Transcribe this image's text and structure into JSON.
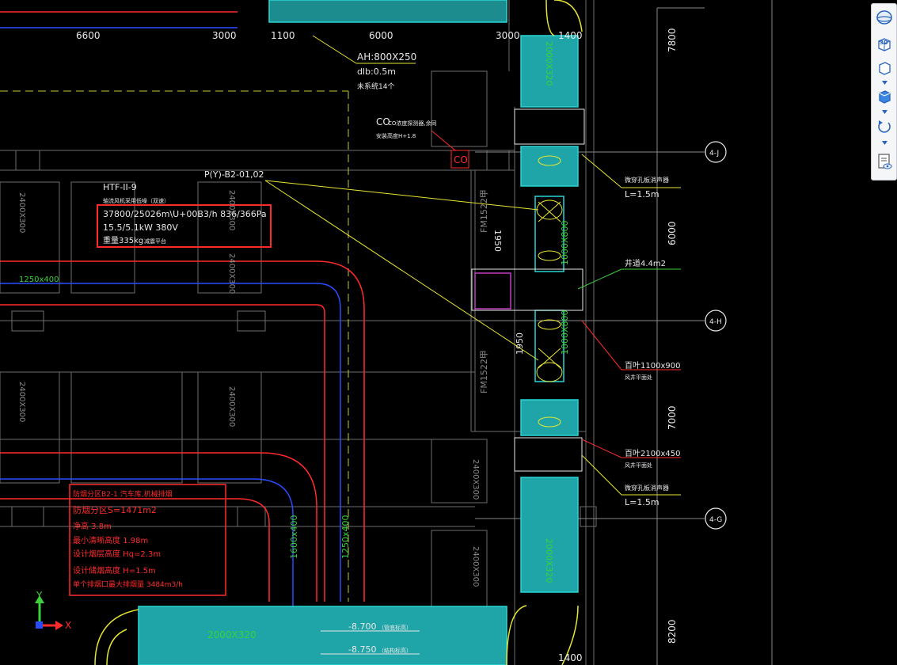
{
  "drawing": {
    "top_dims": [
      "6600",
      "3000",
      "1100",
      "6000",
      "3000",
      "1400"
    ],
    "bottom_dim": "1400",
    "right_dims": [
      "7800",
      "6000",
      "7000",
      "8200"
    ],
    "grid_bubbles": [
      "4-J",
      "4-H",
      "4-G"
    ],
    "duct_ah": "AH:800X250",
    "dlb": "dlb:0.5m",
    "ah_note": "未系统14个",
    "co_label": "CO",
    "co_note1": "CO浓度探测器,余同",
    "co_note2": "安装高度H+1.8",
    "co_box": "CO",
    "fan_tag": "P(Y)-B2-01,02",
    "fan_model": "HTF-II-9",
    "fan_sub": "轴流风机采用低噪（双速）",
    "fan_spec1": "37800/25026m\\U+00B3/h  836/366Pa",
    "fan_spec2": "15.5/5.1kW  380V",
    "fan_spec3": "重量335kg",
    "fan_spec3b": "减震平台",
    "duct_left": "1250x400",
    "duct_2400_labels": [
      "2400X300",
      "2400X300",
      "2400X300",
      "2400X300",
      "2400X300",
      "2400X300",
      "2400X300"
    ],
    "duct_v1": "1600x400",
    "duct_v2": "1250x400",
    "duct_2000_top": "2000X320",
    "duct_2000_right": "2000X320",
    "duct_bottom": "2000X320",
    "duct_1000_a": "1000X800",
    "duct_1000_b": "1000X800",
    "fm1": "FM1522甲",
    "fm2": "FM1522甲",
    "dim_1950a": "1950",
    "dim_1950b": "1950",
    "silencer1_a": "微穿孔板消声器",
    "silencer1_b": "L=1.5m",
    "shaft_area": "井道4.4m2",
    "louver1_a": "百叶1100x900",
    "louver1_b": "风井平面处",
    "louver2_a": "百叶2100x450",
    "louver2_b": "风井平面处",
    "silencer2_a": "微穿孔板消声器",
    "silencer2_b": "L=1.5m",
    "red_note": [
      "防烟分区B2-1  汽车库,机械排烟",
      "防烟分区S=1471m2",
      "净高 3.8m",
      "最小清晰高度 1.98m",
      "设计烟层高度 Hq=2.3m",
      "设计储烟高度 H=1.5m",
      "单个排烟口最大排烟量 3484m3/h"
    ],
    "level1": "-8.700",
    "level1_note": "（管底标高）",
    "level2": "-8.750",
    "level2_note": "（结构标高）",
    "axis_y": "Y",
    "axis_x": "X"
  },
  "viewcube": {
    "btn_3d": "3D"
  },
  "colors": {
    "cyan": "#29d6d6",
    "cyan_fill": "#1fa5a8",
    "red": "#ff2b2b",
    "yellow": "#e6e632",
    "green": "#3ad13a",
    "white": "#e8e8e8",
    "grey": "#7a7a7a",
    "blue": "#2a4cff",
    "magenta": "#c23cc2"
  }
}
